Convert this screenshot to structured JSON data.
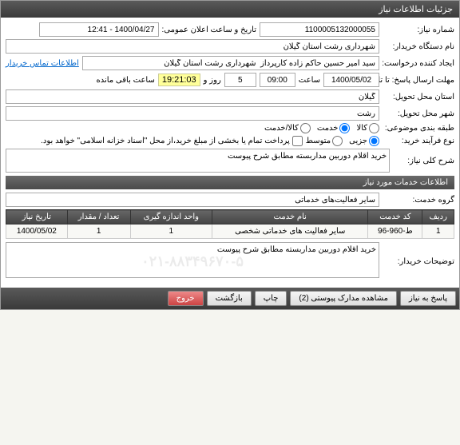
{
  "header": {
    "title": "جزئیات اطلاعات نیاز"
  },
  "fields": {
    "need_number_label": "شماره نیاز:",
    "need_number": "1100005132000055",
    "announce_label": "تاریخ و ساعت اعلان عمومی:",
    "announce_value": "1400/04/27 - 12:41",
    "buyer_label": "نام دستگاه خریدار:",
    "buyer_value": "شهرداری رشت استان گیلان",
    "creator_label": "ایجاد کننده درخواست:",
    "creator_value": "سید امیر حسین حاکم زاده کارپرداز  شهرداری رشت استان گیلان",
    "contact_link": "اطلاعات تماس خریدار",
    "deadline_label": "مهلت ارسال پاسخ: تا تاریخ:",
    "deadline_date": "1400/05/02",
    "saat1": "ساعت",
    "deadline_time": "09:00",
    "rooz_va": "روز و",
    "day_value": "5",
    "remain_time": "19:21:03",
    "remain_label": "ساعت باقی مانده",
    "province_label": "استان محل تحویل:",
    "province_value": "گیلان",
    "city_label": "شهر محل تحویل:",
    "city_value": "رشت",
    "subject_class_label": "طبقه بندی موضوعی:",
    "class_kala": "کالا",
    "class_khedmat": "خدمت",
    "class_kalakhedmat": "کالا/خدمت",
    "process_label": "نوع فرآیند خرید:",
    "proc_jozee": "جزیی",
    "proc_motevaset": "متوسط",
    "payment_note": "پرداخت تمام یا بخشی از مبلغ خرید،از محل \"اسناد خزانه اسلامی\" خواهد بود.",
    "general_desc_label": "شرح کلی نیاز:",
    "general_desc_value": "خرید اقلام دوربین مداربسته مطابق شرح پیوست",
    "services_header": "اطلاعات خدمات مورد نیاز",
    "service_group_label": "گروه خدمت:",
    "service_group_value": "سایر فعالیت‌های خدماتی",
    "buyer_notes_label": "توضیحات خریدار:",
    "buyer_notes_value": "خرید اقلام دوربین مداربسته مطابق شرح پیوست"
  },
  "table": {
    "headers": [
      "ردیف",
      "کد خدمت",
      "نام خدمت",
      "واحد اندازه گیری",
      "تعداد / مقدار",
      "تاریخ نیاز"
    ],
    "rows": [
      {
        "radif": "1",
        "code": "ط-960-96",
        "name": "سایر فعالیت های خدماتی شخصی",
        "unit": "1",
        "qty": "1",
        "date": "1400/05/02"
      }
    ]
  },
  "buttons": {
    "respond": "پاسخ به نیاز",
    "attachments": "مشاهده مدارک پیوستی (2)",
    "print": "چاپ",
    "back": "بازگشت",
    "exit": "خروج"
  },
  "watermark": "۰۲۱-۸۸۳۴۹۶۷۰-۵"
}
